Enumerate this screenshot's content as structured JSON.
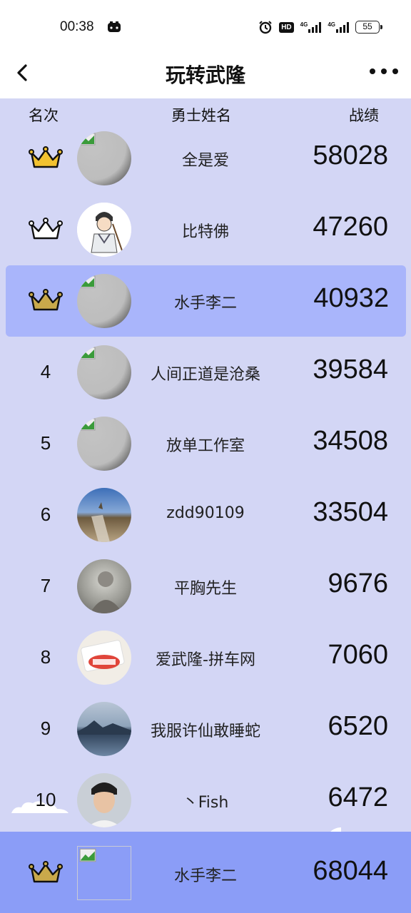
{
  "status_bar": {
    "time": "00:38",
    "hd_badge": "HD",
    "network_1": "4G",
    "network_2": "4G",
    "battery": "55",
    "icons": [
      "game-controller-icon",
      "alarm-icon",
      "hd-icon",
      "signal-icon",
      "signal-icon",
      "battery-icon"
    ]
  },
  "title_bar": {
    "title": "玩转武隆",
    "back_icon": "chevron-left-icon",
    "more_icon": "more-dots-icon"
  },
  "table": {
    "headers": {
      "rank": "名次",
      "name": "勇士姓名",
      "score": "战绩"
    },
    "rows": [
      {
        "rank": "",
        "crown": "gold",
        "name": "全是爱",
        "score": "58028",
        "avatar": "broken-image"
      },
      {
        "rank": "",
        "crown": "silver",
        "name": "比特佛",
        "score": "47260",
        "avatar": "cartoon-warrior"
      },
      {
        "rank": "",
        "crown": "bronze",
        "name": "水手李二",
        "score": "40932",
        "avatar": "broken-image",
        "highlighted": true
      },
      {
        "rank": "4",
        "name": "人间正道是沧桑",
        "score": "39584",
        "avatar": "broken-image"
      },
      {
        "rank": "5",
        "name": "放单工作室",
        "score": "34508",
        "avatar": "broken-image"
      },
      {
        "rank": "6",
        "name": "zdd90109",
        "score": "33504",
        "avatar": "great-wall-photo"
      },
      {
        "rank": "7",
        "name": "平胸先生",
        "score": "9676",
        "avatar": "grey-portrait"
      },
      {
        "rank": "8",
        "name": "爱武隆-拼车网",
        "score": "7060",
        "avatar": "logo-stamp"
      },
      {
        "rank": "9",
        "name": "我服许仙敢睡蛇",
        "score": "6520",
        "avatar": "seascape-photo"
      },
      {
        "rank": "10",
        "name": "丶Fish",
        "score": "6472",
        "avatar": "boy-portrait"
      }
    ]
  },
  "my_rank": {
    "crown": "bronze",
    "name": "水手李二",
    "score": "68044",
    "avatar": "broken-image"
  },
  "colors": {
    "board_bg": "#d3d6f5",
    "highlight_row": "#a9b5fb",
    "footer_bg": "#8b9df7",
    "gold_crown": "#f2c230",
    "bronze_crown": "#c9a94b"
  }
}
